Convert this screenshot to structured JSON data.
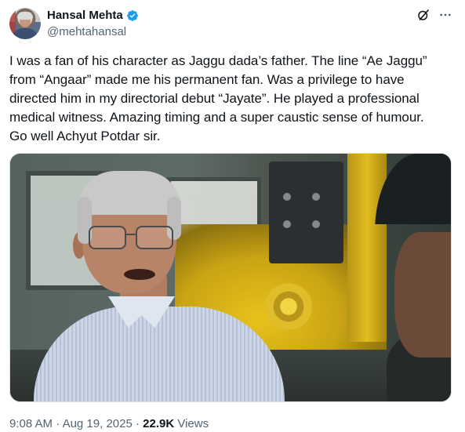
{
  "author": {
    "display_name": "Hansal Mehta",
    "handle": "@mehtahansal",
    "verified_icon": "verified-badge-icon",
    "verified_color": "#1d9bf0"
  },
  "actions": {
    "grok_icon": "grok-slash-icon",
    "more_icon": "more-horizontal-icon",
    "more_label": "···"
  },
  "tweet": {
    "lines": [
      "I was a fan of his character as Jaggu dada’s father. The line “Ae Jaggu”",
      "from “Angaar” made me his permanent fan. Was a privilege to have",
      "directed him in my directorial debut “Jayate”. He played a professional",
      "medical witness. Amazing timing and a super caustic sense of humour.",
      "Go well Achyut Potdar sir."
    ]
  },
  "media": {
    "kind": "photo"
  },
  "meta": {
    "time": "9:08 AM",
    "separator": "·",
    "date": "Aug 19, 2025",
    "views_count": "22.9K",
    "views_label": "Views"
  },
  "colors": {
    "text_primary": "#0f1419",
    "text_secondary": "#536471",
    "accent": "#1d9bf0"
  }
}
